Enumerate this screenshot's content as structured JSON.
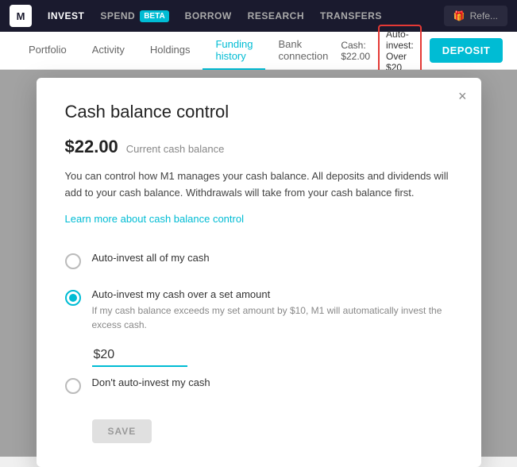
{
  "topNav": {
    "logo": "M",
    "items": [
      {
        "label": "INVEST",
        "active": true
      },
      {
        "label": "SPEND",
        "active": false
      },
      {
        "label": "BETA",
        "badge": true
      },
      {
        "label": "BORROW",
        "active": false
      },
      {
        "label": "RESEARCH",
        "active": false
      },
      {
        "label": "TRANSFERS",
        "active": false
      }
    ],
    "refer_button": "Refe..."
  },
  "secondaryNav": {
    "tabs": [
      {
        "label": "Portfolio",
        "active": false
      },
      {
        "label": "Activity",
        "active": false
      },
      {
        "label": "Holdings",
        "active": false
      },
      {
        "label": "Funding history",
        "active": true
      },
      {
        "label": "Bank connection",
        "active": false
      }
    ],
    "cash_label": "Cash: $22.00",
    "auto_invest_badge": "Auto-invest: Over $20",
    "deposit_button": "DEPOSIT"
  },
  "modal": {
    "title": "Cash balance control",
    "close_icon": "×",
    "cash_amount": "$22.00",
    "cash_label": "Current cash balance",
    "description": "You can control how M1 manages your cash balance. All deposits and dividends will add to your cash balance. Withdrawals will take from your cash balance first.",
    "learn_more_link": "Learn more about cash balance control",
    "options": [
      {
        "id": "all",
        "label": "Auto-invest all of my cash",
        "sublabel": "",
        "selected": false
      },
      {
        "id": "over",
        "label": "Auto-invest my cash over a set amount",
        "sublabel": "If my cash balance exceeds my set amount by $10, M1 will automatically invest the excess cash.",
        "selected": true,
        "amount": "$20"
      },
      {
        "id": "none",
        "label": "Don't auto-invest my cash",
        "sublabel": "",
        "selected": false
      }
    ],
    "save_button": "SAVE"
  }
}
